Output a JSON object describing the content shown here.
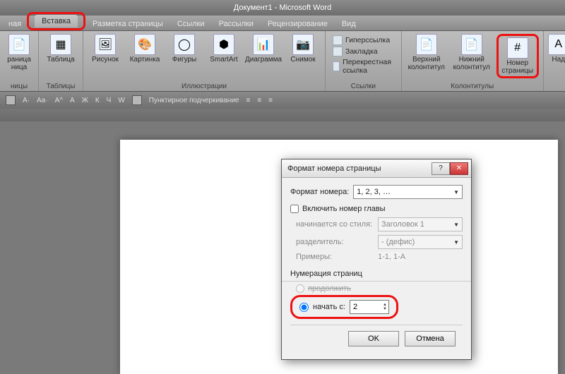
{
  "title": "Документ1 - Microsoft Word",
  "tabs": {
    "t0": "ная",
    "t1": "Вставка",
    "t2": "Разметка страницы",
    "t3": "Ссылки",
    "t4": "Рассылки",
    "t5": "Рецензирование",
    "t6": "Вид"
  },
  "ribbon": {
    "pages": {
      "label": "ницы",
      "btn0_l1": "раница",
      "btn0_l2": "ница"
    },
    "tables": {
      "label": "Таблицы",
      "btn": "Таблица"
    },
    "illus": {
      "label": "Иллюстрации",
      "b1": "Рисунок",
      "b2": "Картинка",
      "b3": "Фигуры",
      "b4": "SmartArt",
      "b5": "Диаграмма",
      "b6": "Снимок"
    },
    "links": {
      "label": "Ссылки",
      "r1": "Гиперссылка",
      "r2": "Закладка",
      "r3": "Перекрестная ссылка"
    },
    "headerfooter": {
      "label": "Колонтитулы",
      "b1_l1": "Верхний",
      "b1_l2": "колонтитул",
      "b2_l1": "Нижний",
      "b2_l2": "колонтитул",
      "b3_l1": "Номер",
      "b3_l2": "страницы"
    },
    "text": {
      "b1": "Над"
    }
  },
  "qat": {
    "item": "Пунктирное подчеркивание"
  },
  "dialog": {
    "title": "Формат номера страницы",
    "format_lbl": "Формат номера:",
    "format_val": "1, 2, 3, …",
    "include_chapter": "Включить номер главы",
    "starts_style_lbl": "начинается со стиля:",
    "starts_style_val": "Заголовок 1",
    "separator_lbl": "разделитель:",
    "separator_val": "- (дефис)",
    "examples_lbl": "Примеры:",
    "examples_val": "1-1, 1-A",
    "numbering_lbl": "Нумерация страниц",
    "continue_lbl": "продолжить",
    "startat_lbl": "начать с:",
    "startat_val": "2",
    "ok": "OK",
    "cancel": "Отмена"
  }
}
